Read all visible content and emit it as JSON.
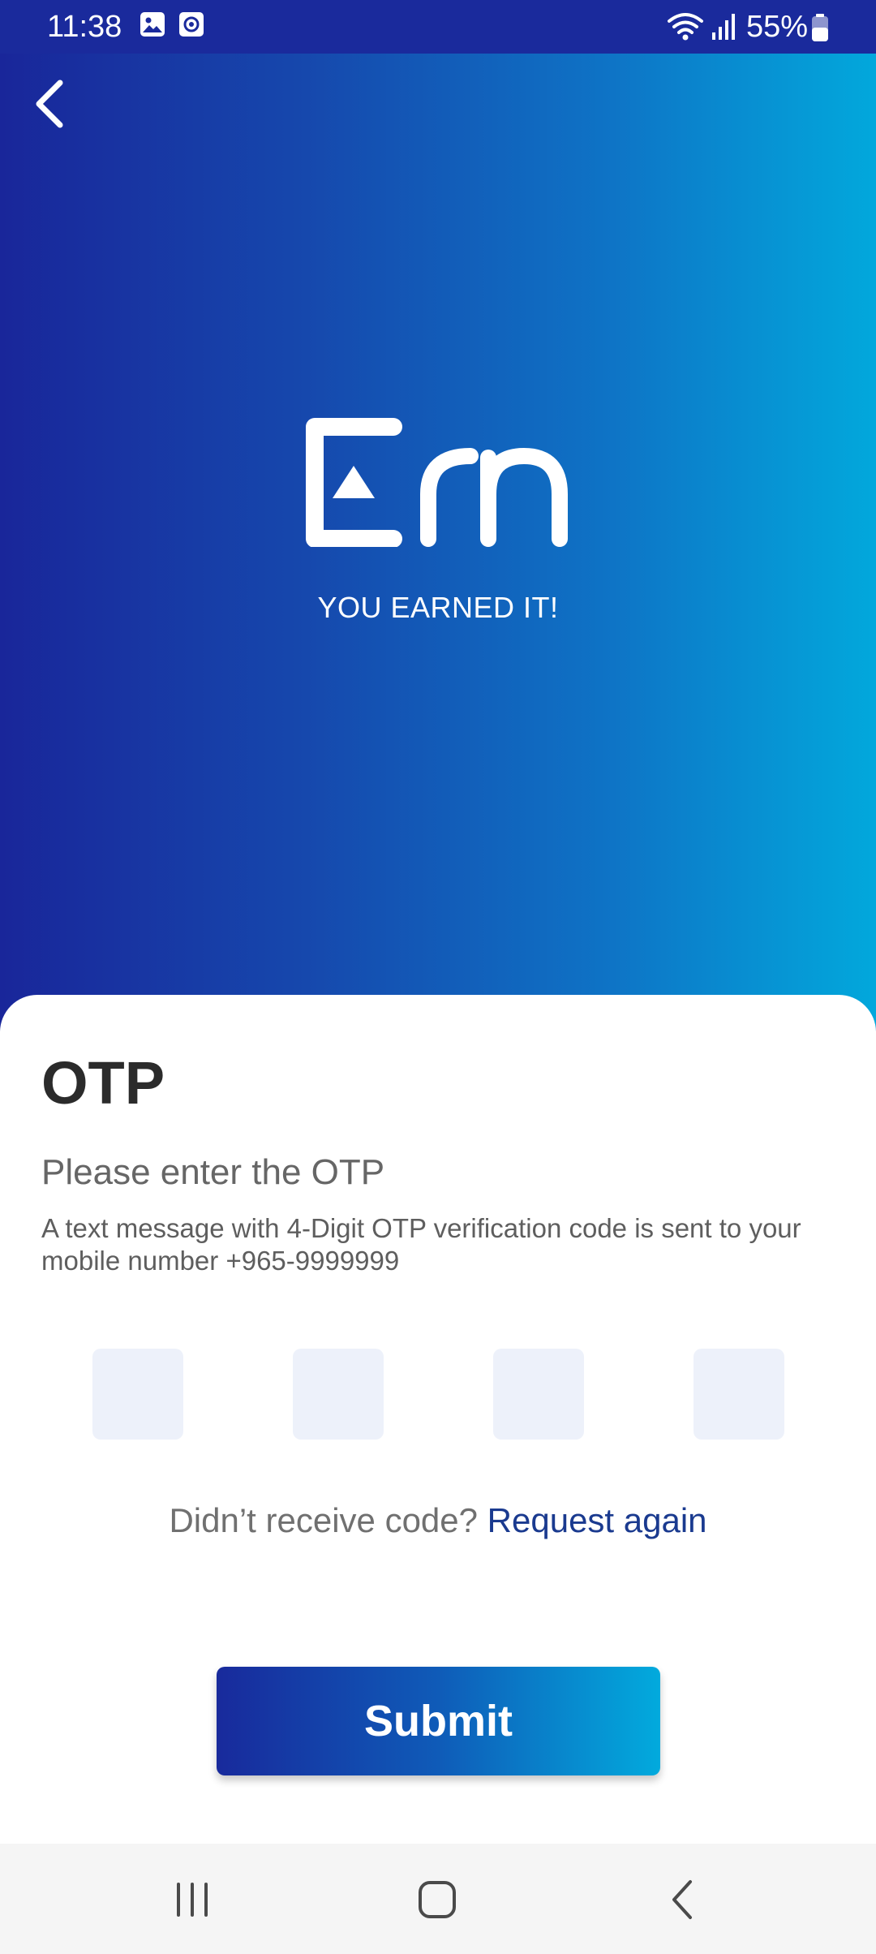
{
  "status_bar": {
    "time": "11:38",
    "battery_percent": "55%",
    "icons": [
      "gallery-icon",
      "screen-recorder-icon",
      "wifi-icon",
      "signal-icon",
      "battery-icon"
    ]
  },
  "hero": {
    "logo_text": "Ern",
    "tagline": "YOU EARNED IT!"
  },
  "otp": {
    "title": "OTP",
    "subtitle": "Please enter the OTP",
    "description": "A text message with 4-Digit OTP verification code is sent to your mobile number +965-9999999",
    "digits": [
      "",
      "",
      "",
      ""
    ],
    "resend_prompt": "Didn’t receive code?",
    "resend_link": "Request again",
    "submit_label": "Submit"
  },
  "colors": {
    "gradient_start": "#19269a",
    "gradient_end": "#02a8dc",
    "otp_box": "#edf1fa",
    "link": "#1a3a8f",
    "title": "#2b2b2b"
  },
  "nav_bar": {
    "buttons": [
      "recent-apps-icon",
      "home-icon",
      "back-icon"
    ]
  }
}
